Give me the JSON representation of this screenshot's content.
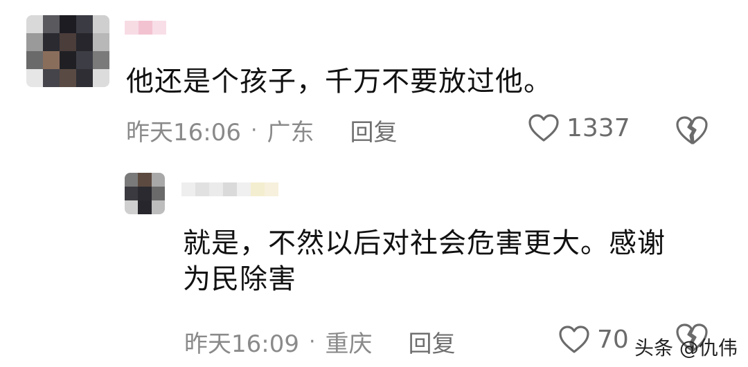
{
  "comments": [
    {
      "text": "他还是个孩子，千万不要放过他。",
      "time": "昨天16:06",
      "location": "广东",
      "reply_label": "回复",
      "likes": "1337"
    },
    {
      "text_line1": "就是，不然以后对社会危害更大。感谢",
      "text_line2": "为民除害",
      "time": "昨天16:09",
      "location": "重庆",
      "reply_label": "回复",
      "likes": "70"
    }
  ],
  "separator": "·",
  "watermark": "头条 @仇伟",
  "icons": {
    "like": "heart-outline-icon",
    "dislike": "broken-heart-icon"
  },
  "colors": {
    "text": "#111111",
    "meta": "#8a8a8a",
    "icon": "#6b6b6b"
  }
}
